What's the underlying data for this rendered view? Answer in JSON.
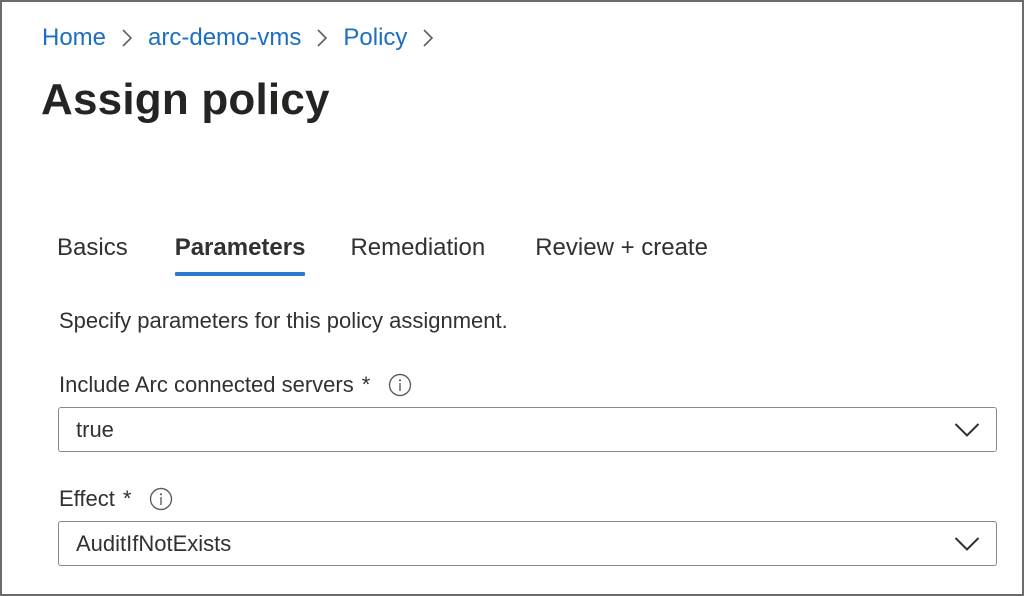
{
  "breadcrumb": {
    "items": [
      "Home",
      "arc-demo-vms",
      "Policy"
    ]
  },
  "page": {
    "title": "Assign policy"
  },
  "tabs": [
    {
      "label": "Basics",
      "active": false
    },
    {
      "label": "Parameters",
      "active": true
    },
    {
      "label": "Remediation",
      "active": false
    },
    {
      "label": "Review + create",
      "active": false
    }
  ],
  "parameters": {
    "description": "Specify parameters for this policy assignment.",
    "include_arc": {
      "label": "Include Arc connected servers",
      "required_mark": "*",
      "value": "true"
    },
    "effect": {
      "label": "Effect",
      "required_mark": "*",
      "value": "AuditIfNotExists"
    }
  },
  "colors": {
    "link": "#1b6ec2",
    "tab_underline": "#2b79d0",
    "frame_border": "#6b6b6b"
  },
  "icons": {
    "breadcrumb_separator": "chevron-right-icon",
    "field_info": "info-icon",
    "dropdown": "chevron-down-icon"
  }
}
